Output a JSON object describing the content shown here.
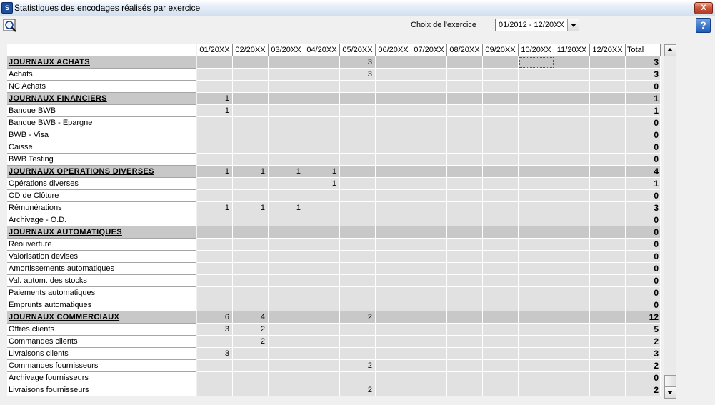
{
  "window": {
    "title": "Statistiques des encodages réalisés par exercice",
    "close_label": "X"
  },
  "toolbar": {
    "exercise_label": "Choix de l'exercice",
    "exercise_value": "01/2012 - 12/20XX",
    "help_label": "?"
  },
  "table": {
    "columns": [
      "01/20XX",
      "02/20XX",
      "03/20XX",
      "04/20XX",
      "05/20XX",
      "06/20XX",
      "07/20XX",
      "08/20XX",
      "09/20XX",
      "10/20XX",
      "11/20XX",
      "12/20XX"
    ],
    "total_label": "Total",
    "rows": [
      {
        "label": "JOURNAUX ACHATS",
        "group": true,
        "values": [
          "",
          "",
          "",
          "",
          "3",
          "",
          "",
          "",
          "",
          "",
          "",
          ""
        ],
        "total": "3"
      },
      {
        "label": "Achats",
        "group": false,
        "values": [
          "",
          "",
          "",
          "",
          "3",
          "",
          "",
          "",
          "",
          "",
          "",
          ""
        ],
        "total": "3"
      },
      {
        "label": "NC Achats",
        "group": false,
        "values": [
          "",
          "",
          "",
          "",
          "",
          "",
          "",
          "",
          "",
          "",
          "",
          ""
        ],
        "total": "0"
      },
      {
        "label": "JOURNAUX FINANCIERS",
        "group": true,
        "values": [
          "1",
          "",
          "",
          "",
          "",
          "",
          "",
          "",
          "",
          "",
          "",
          ""
        ],
        "total": "1"
      },
      {
        "label": "Banque BWB",
        "group": false,
        "values": [
          "1",
          "",
          "",
          "",
          "",
          "",
          "",
          "",
          "",
          "",
          "",
          ""
        ],
        "total": "1"
      },
      {
        "label": "Banque BWB - Epargne",
        "group": false,
        "values": [
          "",
          "",
          "",
          "",
          "",
          "",
          "",
          "",
          "",
          "",
          "",
          ""
        ],
        "total": "0"
      },
      {
        "label": "BWB - Visa",
        "group": false,
        "values": [
          "",
          "",
          "",
          "",
          "",
          "",
          "",
          "",
          "",
          "",
          "",
          ""
        ],
        "total": "0"
      },
      {
        "label": "Caisse",
        "group": false,
        "values": [
          "",
          "",
          "",
          "",
          "",
          "",
          "",
          "",
          "",
          "",
          "",
          ""
        ],
        "total": "0"
      },
      {
        "label": "BWB Testing",
        "group": false,
        "values": [
          "",
          "",
          "",
          "",
          "",
          "",
          "",
          "",
          "",
          "",
          "",
          ""
        ],
        "total": "0"
      },
      {
        "label": "JOURNAUX OPERATIONS DIVERSES",
        "group": true,
        "values": [
          "1",
          "1",
          "1",
          "1",
          "",
          "",
          "",
          "",
          "",
          "",
          "",
          ""
        ],
        "total": "4"
      },
      {
        "label": "Opérations diverses",
        "group": false,
        "values": [
          "",
          "",
          "",
          "1",
          "",
          "",
          "",
          "",
          "",
          "",
          "",
          ""
        ],
        "total": "1"
      },
      {
        "label": "OD de Clôture",
        "group": false,
        "values": [
          "",
          "",
          "",
          "",
          "",
          "",
          "",
          "",
          "",
          "",
          "",
          ""
        ],
        "total": "0"
      },
      {
        "label": "Rémunérations",
        "group": false,
        "values": [
          "1",
          "1",
          "1",
          "",
          "",
          "",
          "",
          "",
          "",
          "",
          "",
          ""
        ],
        "total": "3"
      },
      {
        "label": "Archivage - O.D.",
        "group": false,
        "values": [
          "",
          "",
          "",
          "",
          "",
          "",
          "",
          "",
          "",
          "",
          "",
          ""
        ],
        "total": "0"
      },
      {
        "label": "JOURNAUX AUTOMATIQUES",
        "group": true,
        "values": [
          "",
          "",
          "",
          "",
          "",
          "",
          "",
          "",
          "",
          "",
          "",
          ""
        ],
        "total": "0"
      },
      {
        "label": "Réouverture",
        "group": false,
        "values": [
          "",
          "",
          "",
          "",
          "",
          "",
          "",
          "",
          "",
          "",
          "",
          ""
        ],
        "total": "0"
      },
      {
        "label": "Valorisation devises",
        "group": false,
        "values": [
          "",
          "",
          "",
          "",
          "",
          "",
          "",
          "",
          "",
          "",
          "",
          ""
        ],
        "total": "0"
      },
      {
        "label": "Amortissements automatiques",
        "group": false,
        "values": [
          "",
          "",
          "",
          "",
          "",
          "",
          "",
          "",
          "",
          "",
          "",
          ""
        ],
        "total": "0"
      },
      {
        "label": "Val. autom. des stocks",
        "group": false,
        "values": [
          "",
          "",
          "",
          "",
          "",
          "",
          "",
          "",
          "",
          "",
          "",
          ""
        ],
        "total": "0"
      },
      {
        "label": "Paiements automatiques",
        "group": false,
        "values": [
          "",
          "",
          "",
          "",
          "",
          "",
          "",
          "",
          "",
          "",
          "",
          ""
        ],
        "total": "0"
      },
      {
        "label": "Emprunts automatiques",
        "group": false,
        "values": [
          "",
          "",
          "",
          "",
          "",
          "",
          "",
          "",
          "",
          "",
          "",
          ""
        ],
        "total": "0"
      },
      {
        "label": "JOURNAUX COMMERCIAUX",
        "group": true,
        "values": [
          "6",
          "4",
          "",
          "",
          "2",
          "",
          "",
          "",
          "",
          "",
          "",
          ""
        ],
        "total": "12"
      },
      {
        "label": "Offres clients",
        "group": false,
        "values": [
          "3",
          "2",
          "",
          "",
          "",
          "",
          "",
          "",
          "",
          "",
          "",
          ""
        ],
        "total": "5"
      },
      {
        "label": "Commandes clients",
        "group": false,
        "values": [
          "",
          "2",
          "",
          "",
          "",
          "",
          "",
          "",
          "",
          "",
          "",
          ""
        ],
        "total": "2"
      },
      {
        "label": "Livraisons clients",
        "group": false,
        "values": [
          "3",
          "",
          "",
          "",
          "",
          "",
          "",
          "",
          "",
          "",
          "",
          ""
        ],
        "total": "3"
      },
      {
        "label": "Commandes fournisseurs",
        "group": false,
        "values": [
          "",
          "",
          "",
          "",
          "2",
          "",
          "",
          "",
          "",
          "",
          "",
          ""
        ],
        "total": "2"
      },
      {
        "label": "Archivage fournisseurs",
        "group": false,
        "values": [
          "",
          "",
          "",
          "",
          "",
          "",
          "",
          "",
          "",
          "",
          "",
          ""
        ],
        "total": "0"
      },
      {
        "label": "Livraisons fournisseurs",
        "group": false,
        "values": [
          "",
          "",
          "",
          "",
          "2",
          "",
          "",
          "",
          "",
          "",
          "",
          ""
        ],
        "total": "2"
      }
    ]
  }
}
